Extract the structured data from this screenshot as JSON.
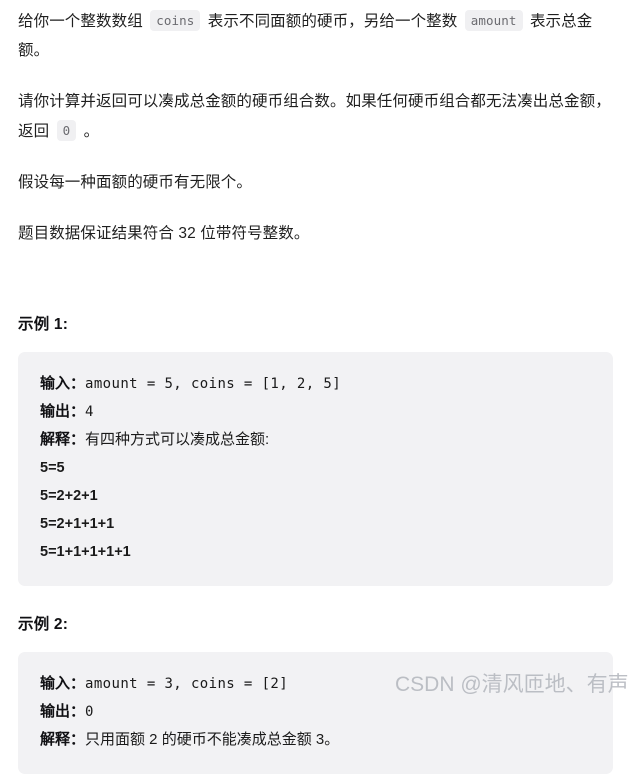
{
  "document": {
    "paragraphs": [
      {
        "id": "intro",
        "parts": [
          {
            "type": "text",
            "value": "给你一个整数数组 "
          },
          {
            "type": "code",
            "value": "coins"
          },
          {
            "type": "text",
            "value": " 表示不同面额的硬币，另给一个整数 "
          },
          {
            "type": "code",
            "value": "amount"
          },
          {
            "type": "text",
            "value": " 表示总金额。"
          }
        ]
      },
      {
        "id": "task",
        "parts": [
          {
            "type": "text",
            "value": "请你计算并返回可以凑成总金额的硬币组合数。如果任何硬币组合都无法凑出总金额，返回 "
          },
          {
            "type": "code",
            "value": "0"
          },
          {
            "type": "text",
            "value": " 。"
          }
        ]
      },
      {
        "id": "assumption",
        "parts": [
          {
            "type": "text",
            "value": "假设每一种面额的硬币有无限个。"
          }
        ]
      },
      {
        "id": "guarantee",
        "parts": [
          {
            "type": "text",
            "value": "题目数据保证结果符合 32 位带符号整数。"
          }
        ]
      }
    ],
    "paragraph_text": {
      "intro_a": "给你一个整数数组 ",
      "intro_code_1": "coins",
      "intro_b": " 表示不同面额的硬币，另给一个整数 ",
      "intro_code_2": "amount",
      "intro_c": " 表示总金额。",
      "task_a": "请你计算并返回可以凑成总金额的硬币组合数。如果任何硬币组合都无法凑出总金额，返回 ",
      "task_code_1": "0",
      "task_b": " 。",
      "assumption": "假设每一种面额的硬币有无限个。",
      "guarantee": "题目数据保证结果符合 32 位带符号整数。"
    },
    "examples": [
      {
        "title": "示例 1:",
        "input_label": "输入：",
        "input_value": "amount = 5, coins = [1, 2, 5]",
        "output_label": "输出：",
        "output_value": "4",
        "explain_label": "解释：",
        "explain_value": "有四种方式可以凑成总金额:",
        "lines": [
          "5=5",
          "5=2+2+1",
          "5=2+1+1+1",
          "5=1+1+1+1+1"
        ]
      },
      {
        "title": "示例 2:",
        "input_label": "输入：",
        "input_value": "amount = 3, coins = [2]",
        "output_label": "输出：",
        "output_value": "0",
        "explain_label": "解释：",
        "explain_value": "只用面额 2 的硬币不能凑成总金额 3。",
        "lines": []
      }
    ]
  },
  "watermark": {
    "text": "CSDN @清风匝地、有声！"
  },
  "colors": {
    "page_background": "#ffffff",
    "text": "#1f1f1f",
    "code_block_background": "#f2f2f4",
    "inline_code_background": "#f0f0f2",
    "inline_code_text": "#6b6b70",
    "watermark": "#b9bcc2"
  }
}
